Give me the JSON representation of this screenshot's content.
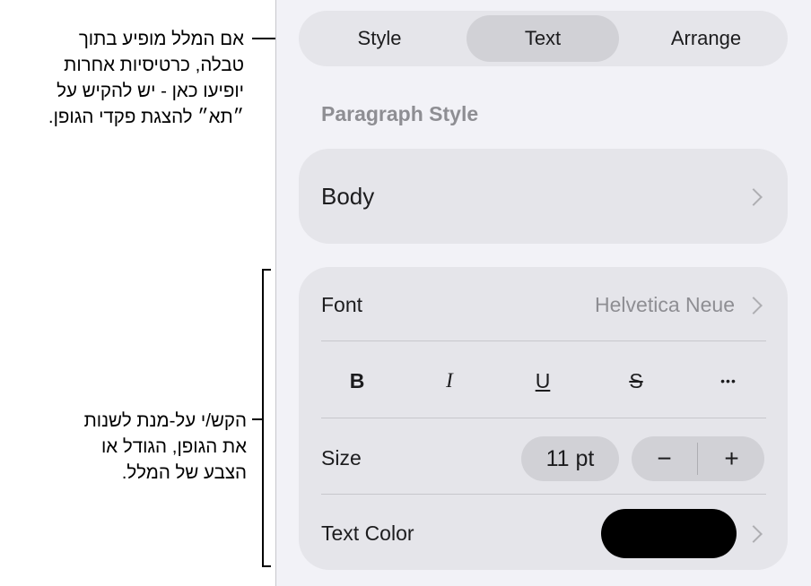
{
  "callouts": {
    "top_lines": [
      "אם המלל מופיע בתוך",
      "טבלה, כרטיסיות אחרות",
      "יופיעו כאן - יש להקיש על",
      "״תא״ להצגת פקדי הגופן."
    ],
    "bottom_lines": [
      "הקש/י על-מנת לשנות",
      "את הגופן, הגודל או",
      "הצבע של המלל."
    ]
  },
  "tabs": [
    {
      "label": "Style",
      "active": false
    },
    {
      "label": "Text",
      "active": true
    },
    {
      "label": "Arrange",
      "active": false
    }
  ],
  "paragraph_style": {
    "heading": "Paragraph Style",
    "value": "Body"
  },
  "font_section": {
    "font_label": "Font",
    "font_value": "Helvetica Neue",
    "format_buttons": {
      "bold": "B",
      "italic": "I",
      "underline": "U",
      "strikethrough": "S",
      "more": "•••"
    },
    "size_label": "Size",
    "size_value": "11 pt",
    "decrease": "−",
    "increase": "+",
    "text_color_label": "Text Color",
    "text_color": "#000000"
  },
  "colors": {
    "panel_bg": "#f2f2f7",
    "card_bg": "#e5e5ea",
    "active_tab_bg": "#d1d1d6",
    "secondary_text": "#8e8e93"
  }
}
